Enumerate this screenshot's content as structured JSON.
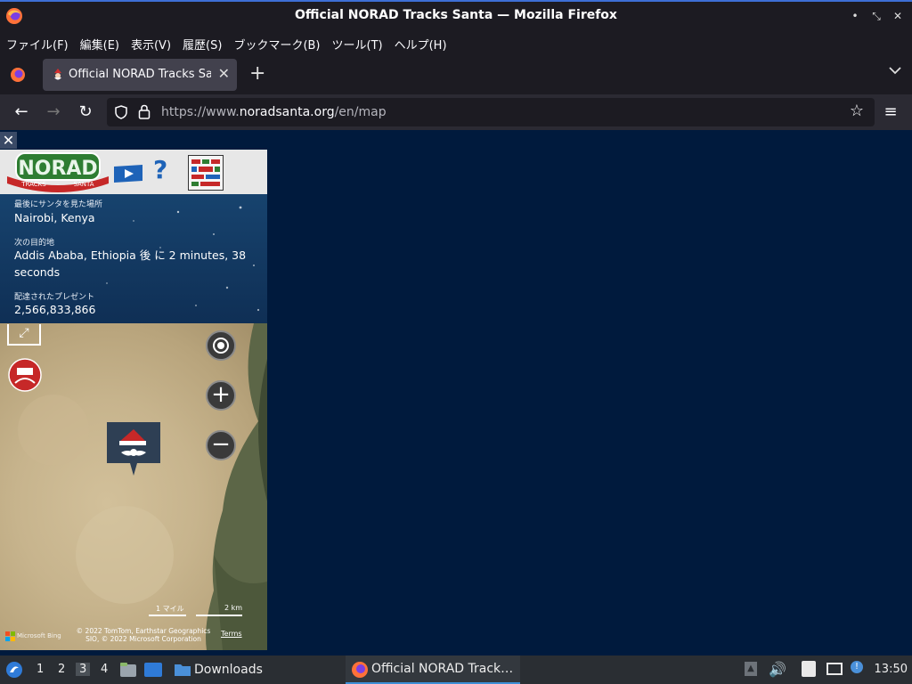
{
  "window": {
    "title": "Official NORAD Tracks Santa — Mozilla Firefox"
  },
  "menu": [
    "ファイル(F)",
    "編集(E)",
    "表示(V)",
    "履歴(S)",
    "ブックマーク(B)",
    "ツール(T)",
    "ヘルプ(H)"
  ],
  "tab": {
    "label": "Official NORAD Tracks Santa"
  },
  "urlbar": {
    "prefix": "https://www.",
    "domain": "noradsanta.org",
    "path": "/en/map"
  },
  "tracker": {
    "logo_text": "NORAD",
    "logo_sub_left": "TRACKS",
    "logo_sub_right": "SANTA",
    "last_seen_label": "最後にサンタを見た場所",
    "last_seen_value": "Nairobi, Kenya",
    "next_label": "次の目的地",
    "next_value": "Addis Ababa, Ethiopia 後 に 2 minutes, 38 seconds",
    "gifts_label": "配達されたプレゼント",
    "gifts_value": "2,566,833,866",
    "help_glyph": "?"
  },
  "map": {
    "scale_left": "1 マイル",
    "scale_right": "2 km",
    "attribution": "© 2022 TomTom, Earthstar Geographics SIO, © 2022 Microsoft Corporation",
    "terms": "Terms",
    "brand": "Microsoft Bing"
  },
  "taskbar": {
    "workspaces": [
      "1",
      "2",
      "3",
      "4"
    ],
    "active_workspace": "3",
    "downloads_label": "Downloads",
    "task_label": "Official NORAD Track…",
    "clock": "13:50"
  },
  "colors": {
    "page_bg": "#001a3d",
    "chrome_bg": "#1c1b22",
    "navbar_bg": "#2b2a33",
    "accent": "#3d8fd6"
  }
}
